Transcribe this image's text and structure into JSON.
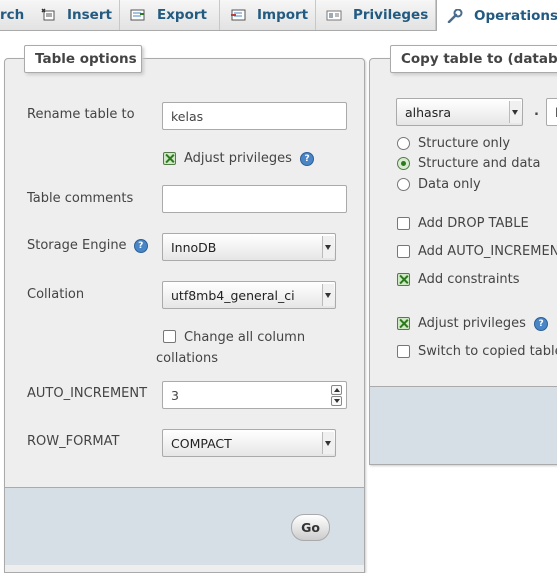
{
  "tabs": [
    {
      "label": "rch"
    },
    {
      "label": "Insert",
      "icon": "insert-icon"
    },
    {
      "label": "Export",
      "icon": "export-icon"
    },
    {
      "label": "Import",
      "icon": "import-icon"
    },
    {
      "label": "Privileges",
      "icon": "privileges-icon"
    },
    {
      "label": "Operations",
      "icon": "wrench-icon"
    }
  ],
  "table_options": {
    "legend": "Table options",
    "rename_label": "Rename table to",
    "rename_value": "kelas",
    "adjust_privileges_label": "Adjust privileges",
    "adjust_privileges_checked": true,
    "comments_label": "Table comments",
    "comments_value": "",
    "engine_label": "Storage Engine",
    "engine_value": "InnoDB",
    "collation_label": "Collation",
    "collation_value": "utf8mb4_general_ci",
    "change_collations_line1": "Change all column",
    "change_collations_line2": "collations",
    "change_collations_checked": false,
    "auto_increment_label": "AUTO_INCREMENT",
    "auto_increment_value": "3",
    "row_format_label": "ROW_FORMAT",
    "row_format_value": "COMPACT",
    "go_label": "Go"
  },
  "copy_table": {
    "legend": "Copy table to (database",
    "database_value": "alhasra",
    "separator": ".",
    "table_value": "k",
    "radio_structure_only": "Structure only",
    "radio_structure_and_data": "Structure and data",
    "radio_data_only": "Data only",
    "selected_radio": "Structure and data",
    "add_drop_table": "Add DROP TABLE",
    "add_auto_increment": "Add AUTO_INCREMEN",
    "add_constraints": "Add constraints",
    "adjust_privileges": "Adjust privileges",
    "switch_to_copied": "Switch to copied table"
  },
  "colors": {
    "tab_text": "#235a81",
    "panel_bg": "#eeeeee",
    "footer_bg": "#d6dee6",
    "help_icon": "#4a86c5"
  }
}
